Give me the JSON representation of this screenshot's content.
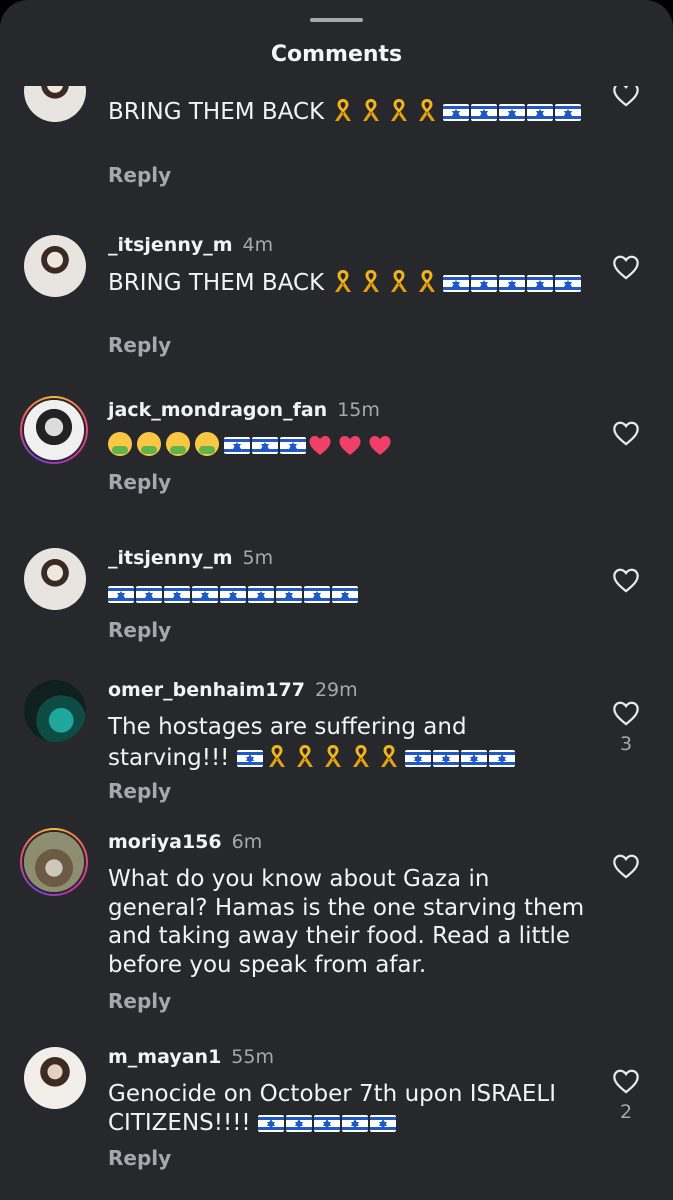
{
  "header": {
    "title": "Comments"
  },
  "reply_label": "Reply",
  "comments": [
    {
      "username": "",
      "time": "",
      "text": "BRING THEM BACK",
      "emoji": [
        "ribbon",
        "ribbon",
        "ribbon",
        "ribbon",
        "flag",
        "flag",
        "flag",
        "flag",
        "flag"
      ],
      "likes": ""
    },
    {
      "username": "_itsjenny_m",
      "time": "4m",
      "text": "BRING THEM BACK",
      "emoji": [
        "ribbon",
        "ribbon",
        "ribbon",
        "ribbon",
        "flag",
        "flag",
        "flag",
        "flag",
        "flag"
      ],
      "likes": ""
    },
    {
      "username": "jack_mondragon_fan",
      "time": "15m",
      "text": "",
      "emoji": [
        "nauseated-face",
        "nauseated-face",
        "nauseated-face",
        "nauseated-face",
        "flag",
        "flag",
        "flag",
        "heart",
        "heart",
        "heart"
      ],
      "likes": ""
    },
    {
      "username": "_itsjenny_m",
      "time": "5m",
      "text": "",
      "emoji": [
        "flag",
        "flag",
        "flag",
        "flag",
        "flag",
        "flag",
        "flag",
        "flag",
        "flag"
      ],
      "likes": ""
    },
    {
      "username": "omer_benhaim177",
      "time": "29m",
      "text": "The hostages are suffering and starving!!!",
      "emoji": [
        "flag",
        "ribbon",
        "ribbon",
        "ribbon",
        "ribbon",
        "ribbon",
        "flag",
        "flag",
        "flag",
        "flag"
      ],
      "likes": "3"
    },
    {
      "username": "moriya156",
      "time": "6m",
      "text": "What do you know about Gaza in general? Hamas is the one starving them and taking away their food. Read a little before you speak from afar.",
      "emoji": [],
      "likes": ""
    },
    {
      "username": "m_mayan1",
      "time": "55m",
      "text": "Genocide on October 7th upon ISRAELI CITIZENS!!!!",
      "emoji": [
        "flag",
        "flag",
        "flag",
        "flag",
        "flag"
      ],
      "likes": "2"
    }
  ],
  "colors": {
    "sheet_bg": "#26282c",
    "text": "#f2f3f5",
    "muted": "#a5a8ae",
    "accent_ring": "#c330a5"
  },
  "icons": {
    "like": "heart-outline-icon"
  }
}
